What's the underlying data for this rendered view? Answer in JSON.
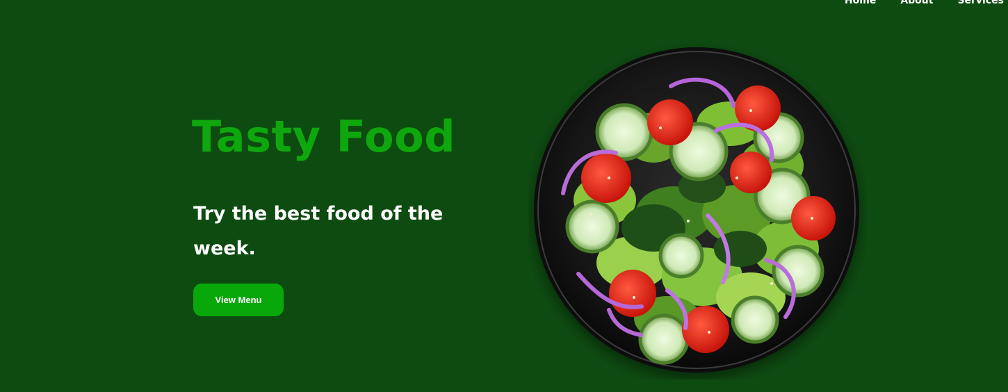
{
  "nav": {
    "items": [
      {
        "label": "Home"
      },
      {
        "label": "About"
      },
      {
        "label": "Services"
      }
    ]
  },
  "hero": {
    "title": "Tasty Food",
    "subtitle": "Try the best food of the week.",
    "button_label": "View Menu",
    "image": {
      "icon": "salad-bowl-image"
    }
  },
  "colors": {
    "background": "#0e4b11",
    "accent": "#0ea70d",
    "button": "#08a80a",
    "text": "#ffffff",
    "plate": "#141414"
  }
}
